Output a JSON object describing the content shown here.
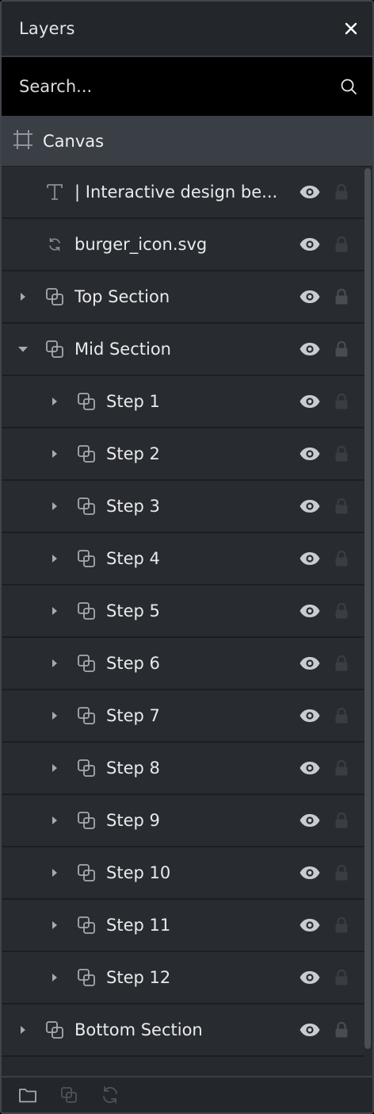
{
  "panel": {
    "title": "Layers",
    "close_icon": "close-icon"
  },
  "search": {
    "placeholder": "Search...",
    "icon": "search-icon"
  },
  "canvas": {
    "label": "Canvas",
    "icon": "artboard-icon"
  },
  "layers": [
    {
      "label": "| Interactive design be...",
      "icon": "text-icon",
      "caret": "none",
      "indent": 0,
      "locked_style": "dim"
    },
    {
      "label": "burger_icon.svg",
      "icon": "svg-sync-icon",
      "caret": "none",
      "indent": 0,
      "locked_style": "dim"
    },
    {
      "label": "Top Section",
      "icon": "group-icon",
      "caret": "collapsed",
      "indent": 0,
      "locked_style": "normal"
    },
    {
      "label": "Mid Section",
      "icon": "group-icon",
      "caret": "expanded",
      "indent": 0,
      "locked_style": "normal"
    },
    {
      "label": "Step 1",
      "icon": "group-icon",
      "caret": "collapsed",
      "indent": 1,
      "locked_style": "dim"
    },
    {
      "label": "Step 2",
      "icon": "group-icon",
      "caret": "collapsed",
      "indent": 1,
      "locked_style": "dim"
    },
    {
      "label": "Step 3",
      "icon": "group-icon",
      "caret": "collapsed",
      "indent": 1,
      "locked_style": "dim"
    },
    {
      "label": "Step 4",
      "icon": "group-icon",
      "caret": "collapsed",
      "indent": 1,
      "locked_style": "dim"
    },
    {
      "label": "Step 5",
      "icon": "group-icon",
      "caret": "collapsed",
      "indent": 1,
      "locked_style": "dim"
    },
    {
      "label": "Step 6",
      "icon": "group-icon",
      "caret": "collapsed",
      "indent": 1,
      "locked_style": "dim"
    },
    {
      "label": "Step 7",
      "icon": "group-icon",
      "caret": "collapsed",
      "indent": 1,
      "locked_style": "dim"
    },
    {
      "label": "Step 8",
      "icon": "group-icon",
      "caret": "collapsed",
      "indent": 1,
      "locked_style": "dim"
    },
    {
      "label": "Step 9",
      "icon": "group-icon",
      "caret": "collapsed",
      "indent": 1,
      "locked_style": "dim"
    },
    {
      "label": "Step 10",
      "icon": "group-icon",
      "caret": "collapsed",
      "indent": 1,
      "locked_style": "dim"
    },
    {
      "label": "Step 11",
      "icon": "group-icon",
      "caret": "collapsed",
      "indent": 1,
      "locked_style": "dim"
    },
    {
      "label": "Step 12",
      "icon": "group-icon",
      "caret": "collapsed",
      "indent": 1,
      "locked_style": "dim"
    },
    {
      "label": "Bottom Section",
      "icon": "group-icon",
      "caret": "collapsed",
      "indent": 0,
      "locked_style": "normal"
    }
  ],
  "footer": {
    "buttons": [
      "folder-icon",
      "group-icon",
      "sync-icon"
    ]
  },
  "colors": {
    "panel_bg": "#26292e",
    "header_bg": "#23262b",
    "search_bg": "#000000",
    "canvas_row_bg": "#3a3e45",
    "row_bg": "#282b30",
    "text": "#e8eaed",
    "icon_muted": "#8a8e95",
    "eye": "#c9ccd1"
  }
}
